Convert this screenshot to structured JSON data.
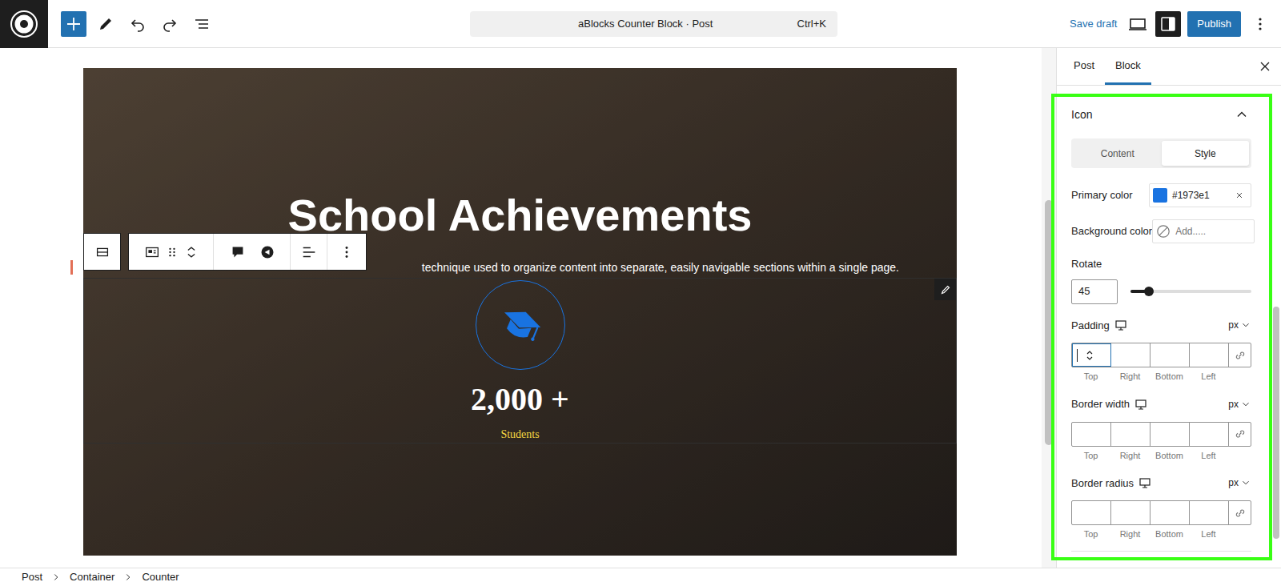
{
  "editor": {
    "document_title": "aBlocks Counter Block · Post",
    "shortcut": "Ctrl+K",
    "save_draft": "Save draft",
    "publish": "Publish",
    "settings_open": true
  },
  "canvas": {
    "heading": "School Achievements",
    "subtitle": "technique used to organize content into separate, easily navigable sections within a single page.",
    "counter": {
      "number": "2,000 +",
      "label": "Students",
      "selected": true
    }
  },
  "sidebar": {
    "tabs": [
      {
        "label": "Post",
        "selected": false
      },
      {
        "label": "Block",
        "selected": true
      }
    ],
    "panel": {
      "title": "Icon",
      "expanded": true,
      "modes": [
        {
          "label": "Content",
          "selected": false
        },
        {
          "label": "Style",
          "selected": true
        }
      ],
      "primary_color": {
        "label": "Primary color",
        "value": "#1973e1"
      },
      "background_color": {
        "label": "Background color",
        "placeholder": "Add....."
      },
      "rotate": {
        "label": "Rotate",
        "value": "45",
        "level": 0.125
      },
      "box_fields": [
        {
          "label": "Padding",
          "unit": "px",
          "focused": true,
          "sides": [
            "Top",
            "Right",
            "Bottom",
            "Left"
          ]
        },
        {
          "label": "Border width",
          "unit": "px",
          "focused": false,
          "sides": [
            "Top",
            "Right",
            "Bottom",
            "Left"
          ]
        },
        {
          "label": "Border radius",
          "unit": "px",
          "focused": false,
          "sides": [
            "Top",
            "Right",
            "Bottom",
            "Left"
          ]
        }
      ]
    }
  },
  "breadcrumb": [
    "Post",
    "Container",
    "Counter"
  ]
}
